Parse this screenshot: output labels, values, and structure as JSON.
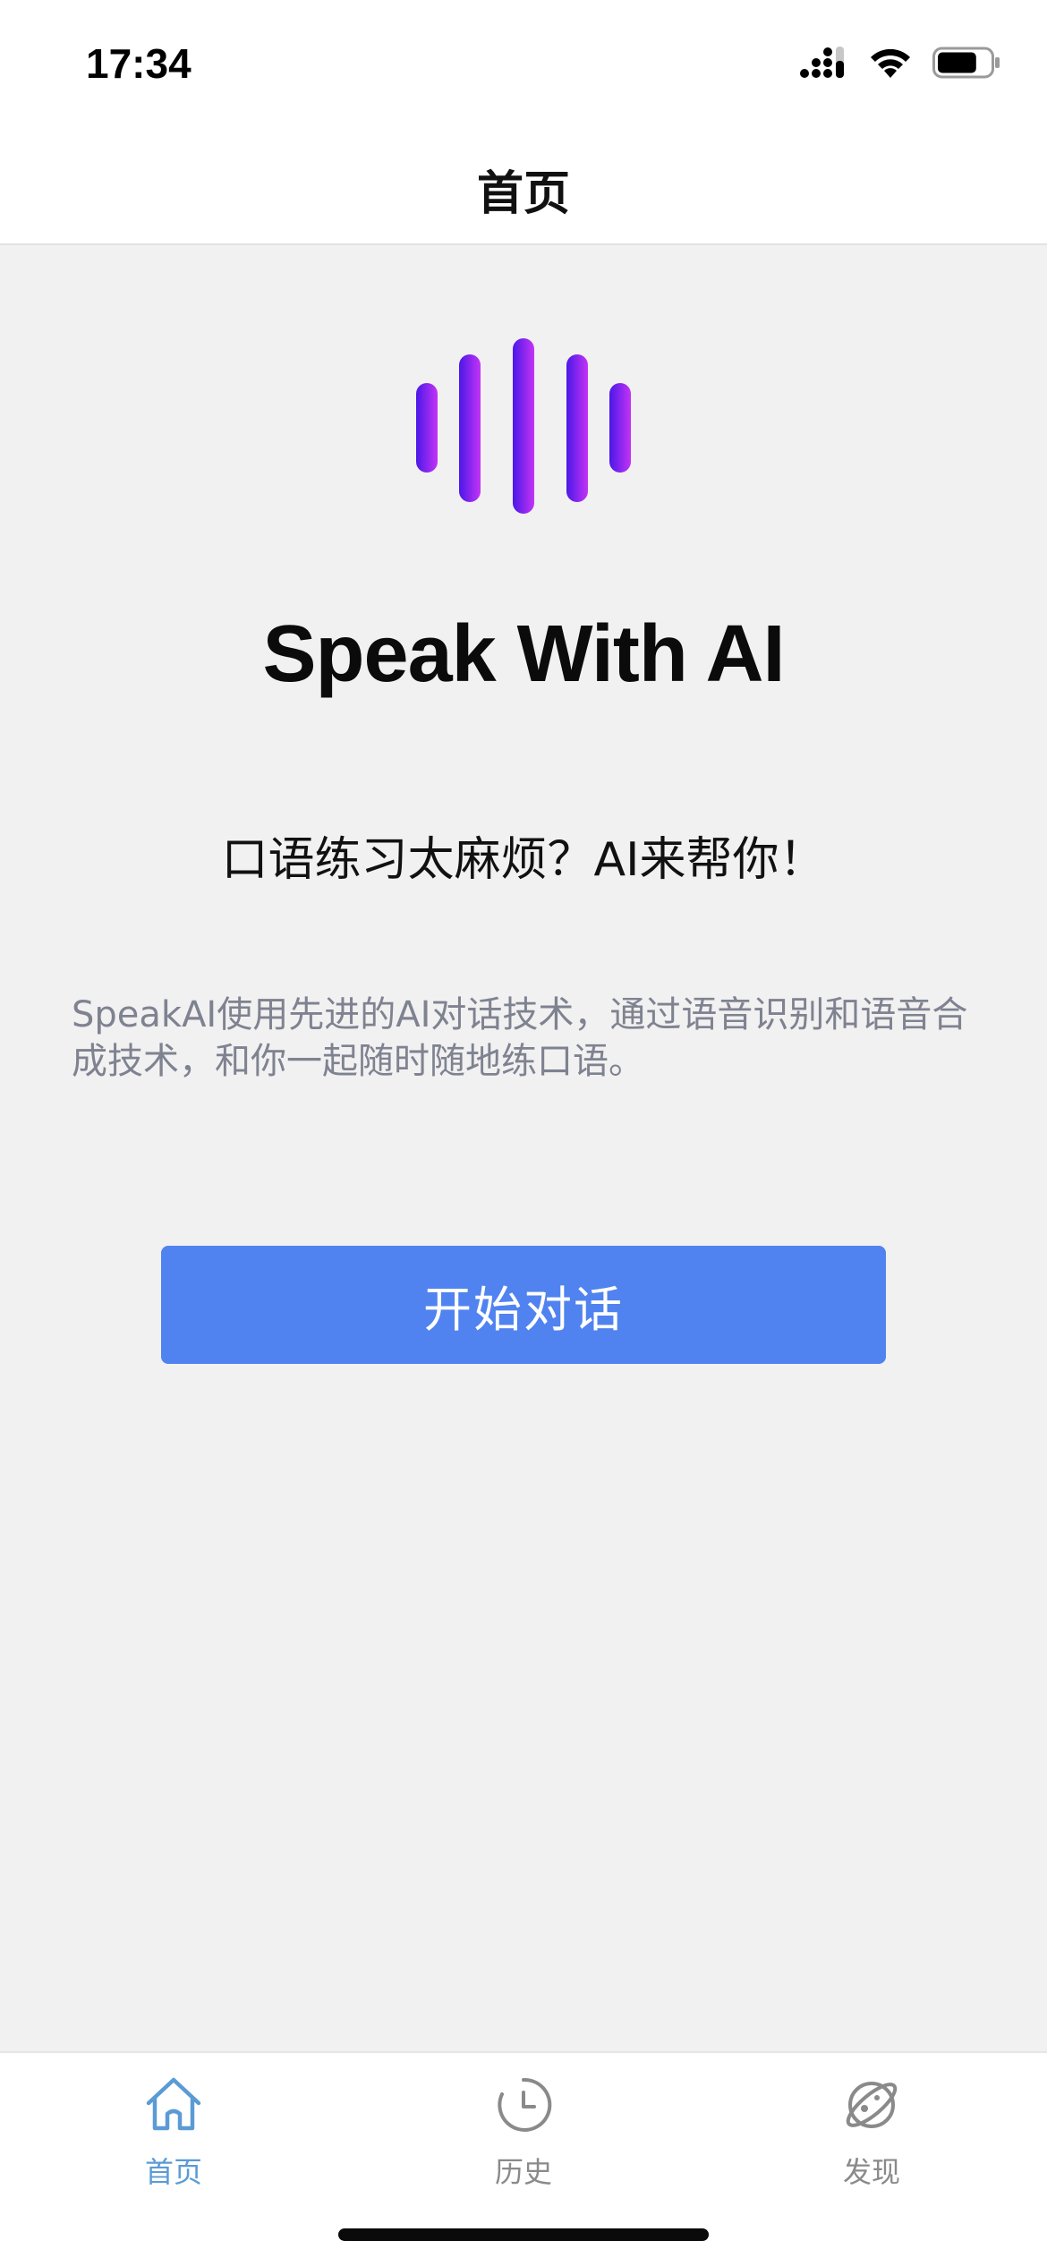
{
  "status_bar": {
    "time": "17:34",
    "battery_level": 0.75
  },
  "nav": {
    "title": "首页"
  },
  "hero": {
    "title": "Speak With AI",
    "subtitle": "口语练习太麻烦？AI来帮你！",
    "description": "SpeakAI使用先进的AI对话技术，通过语音识别和语音合成技术，和你一起随时随地练口语。",
    "start_button_label": "开始对话"
  },
  "tabs": [
    {
      "label": "首页",
      "icon": "home-icon",
      "active": true
    },
    {
      "label": "历史",
      "icon": "clock-icon",
      "active": false
    },
    {
      "label": "发现",
      "icon": "planet-icon",
      "active": false
    }
  ],
  "colors": {
    "accent": "#5083ef",
    "tab_active": "#5b9bd5",
    "tab_inactive": "#8a8a8a",
    "logo_gradient_start": "#4a18e8",
    "logo_gradient_end": "#c433f5"
  }
}
